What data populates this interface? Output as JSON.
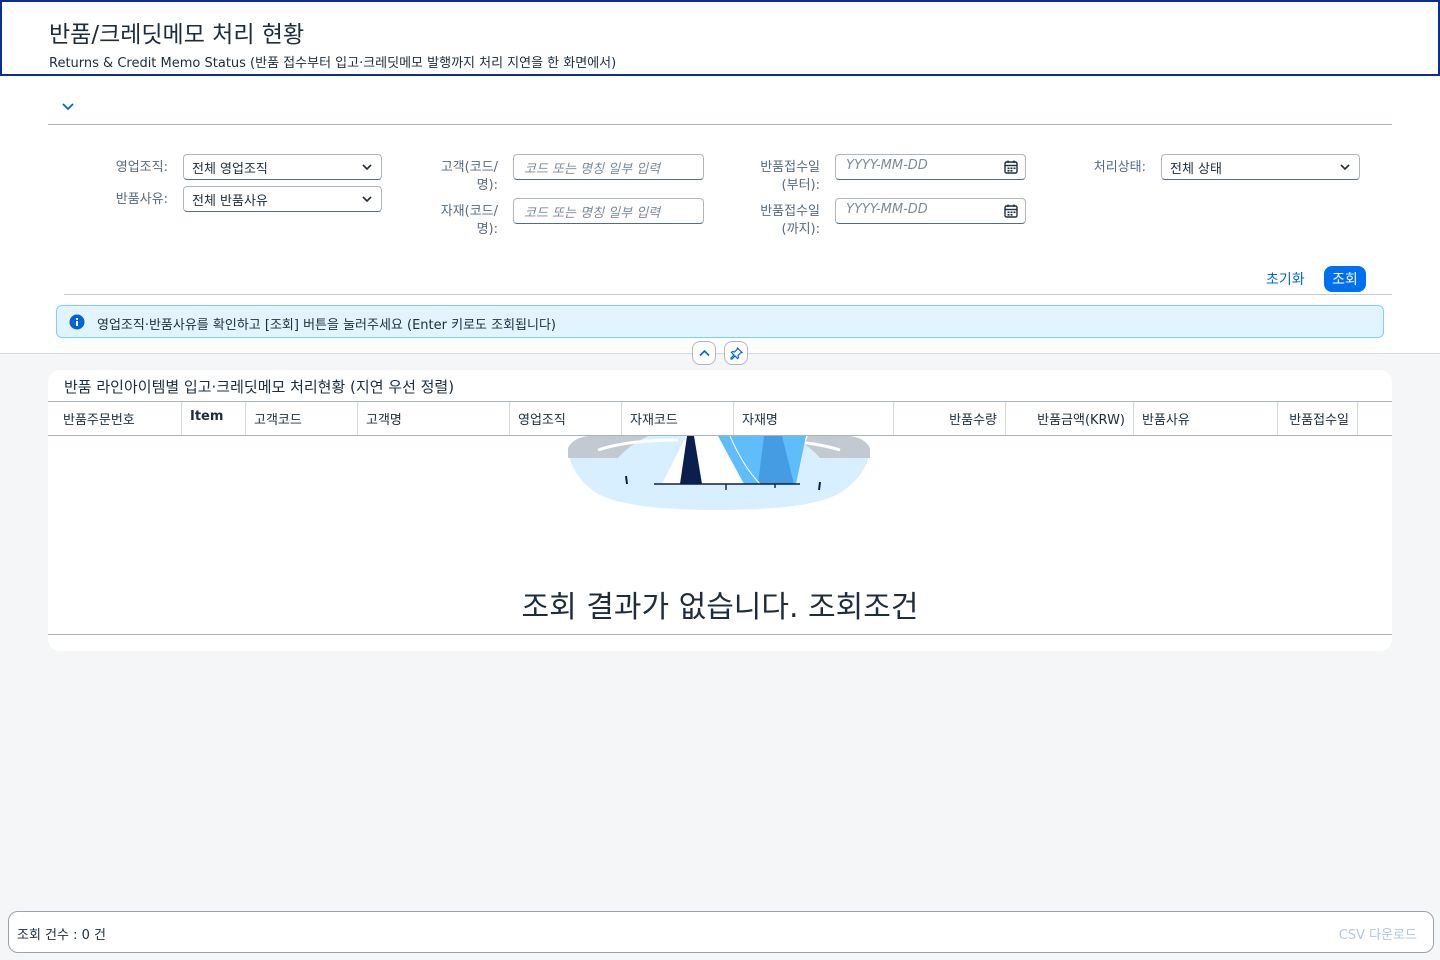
{
  "header": {
    "title": "반품/크레딧메모 처리 현황",
    "subtitle": "Returns & Credit Memo Status (반품 접수부터 입고·크레딧메모 발행까지 처리 지연을 한 화면에서)"
  },
  "filters": {
    "sales_org": {
      "label": "영업조직:",
      "value": "전체 영업조직"
    },
    "return_reason": {
      "label": "반품사유:",
      "value": "전체 반품사유"
    },
    "customer": {
      "label_line1": "고객(코드/",
      "label_line2": "명):",
      "placeholder": "코드 또는 명칭 일부 입력"
    },
    "material": {
      "label_line1": "자재(코드/",
      "label_line2": "명):",
      "placeholder": "코드 또는 명칭 일부 입력"
    },
    "date_from": {
      "label_line1": "반품접수일",
      "label_line2": "(부터):",
      "placeholder": "YYYY-MM-DD"
    },
    "date_to": {
      "label_line1": "반품접수일",
      "label_line2": "(까지):",
      "placeholder": "YYYY-MM-DD"
    },
    "status": {
      "label": "처리상태:",
      "value": "전체 상태"
    },
    "reset_label": "초기화",
    "search_label": "조회"
  },
  "info_strip": {
    "text": "영업조직·반품사유를 확인하고 [조회] 버튼을 눌러주세요 (Enter 키로도 조회됩니다)"
  },
  "table": {
    "title": "반품 라인아이템별 입고·크레딧메모 처리현황 (지연 우선 정렬)",
    "columns": [
      "반품주문번호",
      "Item",
      "고객코드",
      "고객명",
      "영업조직",
      "자재코드",
      "자재명",
      "반품수량",
      "반품금액(KRW)",
      "반품사유",
      "반품접수일"
    ],
    "empty_message": "조회 결과가 없습니다. 조회조건"
  },
  "footer": {
    "count_text": "조회 건수 : 0 건",
    "csv_label": "CSV 다운로드"
  },
  "colors": {
    "accent": "#0070f2",
    "header_border": "#0a2f96",
    "info_bg": "#e1f4ff"
  }
}
